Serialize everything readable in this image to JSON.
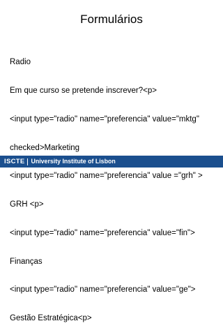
{
  "slide": {
    "title": "Formulários",
    "lines": [
      "Radio",
      "Em que curso se pretende inscrever?<p>",
      "<input type=\"radio\" name=\"preferencia\" value=\"mktg\"",
      "checked>Marketing",
      "<input type=\"radio\" name=\"preferencia\" value =\"grh\" >",
      "GRH <p>",
      "<input type=\"radio\" name=\"preferencia\" value=\"fin\">",
      "Finanças",
      "<input type=\"radio\" name=\"preferencia\" value=\"ge\">",
      "Gestão Estratégica<p>"
    ]
  },
  "footer": {
    "logo_mark": "ISCTE",
    "institution": "University Institute of Lisbon",
    "background_color": "#1b4f8e"
  }
}
